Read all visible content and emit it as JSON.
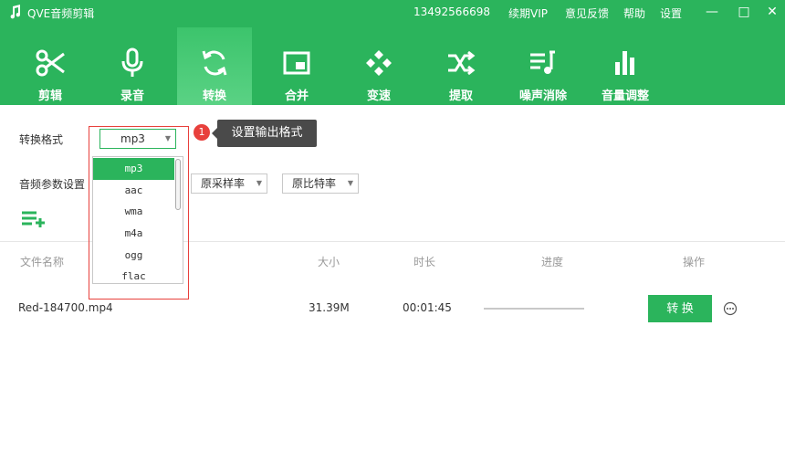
{
  "titlebar": {
    "app_title": "QVE音频剪辑",
    "phone": "13492566698",
    "links": [
      "续期VIP",
      "意见反馈",
      "帮助",
      "设置"
    ],
    "minimize": "—",
    "maximize": "□",
    "close": "✕"
  },
  "toolbar": {
    "items": [
      {
        "label": "剪辑",
        "icon": "scissors-icon"
      },
      {
        "label": "录音",
        "icon": "microphone-icon"
      },
      {
        "label": "转换",
        "icon": "convert-icon"
      },
      {
        "label": "合并",
        "icon": "merge-icon"
      },
      {
        "label": "变速",
        "icon": "speed-icon"
      },
      {
        "label": "提取",
        "icon": "shuffle-icon"
      },
      {
        "label": "噪声消除",
        "icon": "noise-icon"
      },
      {
        "label": "音量调整",
        "icon": "volume-bars-icon"
      }
    ],
    "active_index": 2
  },
  "settings": {
    "format_label": "转换格式",
    "format_value": "mp3",
    "params_label": "音频参数设置",
    "sample_rate": "原采样率",
    "bitrate": "原比特率",
    "hint_number": "1",
    "hint_text": "设置输出格式"
  },
  "dropdown": {
    "options": [
      "mp3",
      "aac",
      "wma",
      "m4a",
      "ogg",
      "flac"
    ],
    "selected_index": 0
  },
  "table": {
    "headers": [
      "文件名称",
      "大小",
      "时长",
      "进度",
      "操作"
    ],
    "rows": [
      {
        "name": "Red-184700.mp4",
        "size": "31.39M",
        "duration": "00:01:45",
        "progress": 0,
        "action": "转 换"
      }
    ]
  },
  "colors": {
    "accent": "#2bb45c",
    "highlight": "#e8403c"
  }
}
